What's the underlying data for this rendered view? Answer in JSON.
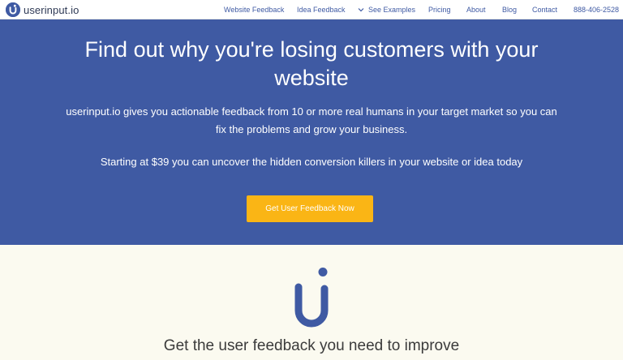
{
  "brand": {
    "name": "userinput.io",
    "icon": "userinput-logo-icon",
    "accent": "#3f5aa3",
    "cta_color": "#fab515"
  },
  "nav": {
    "website_feedback": "Website Feedback",
    "idea_feedback": "Idea Feedback",
    "see_examples": "See Examples",
    "pricing": "Pricing",
    "about": "About",
    "blog": "Blog",
    "contact": "Contact",
    "phone": "888-406-2528"
  },
  "hero": {
    "title": "Find out why you're losing customers with your website",
    "description": "userinput.io gives you actionable feedback from 10 or more real humans in your target market so you can fix the problems and grow your business.",
    "pricing_line": "Starting at $39 you can uncover the hidden conversion killers in your website or idea today",
    "cta_label": "Get User Feedback Now"
  },
  "section": {
    "tagline": "Get the user feedback you need to improve"
  }
}
